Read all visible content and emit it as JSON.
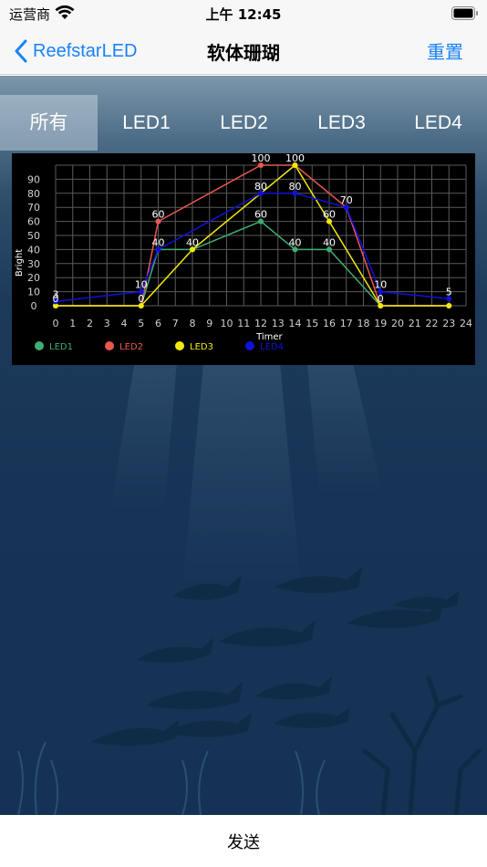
{
  "status_bar": {
    "carrier": "运营商",
    "time": "上午 12:45"
  },
  "nav": {
    "back_label": "ReefstarLED",
    "title": "软体珊瑚",
    "reset_label": "重置"
  },
  "tabs": [
    {
      "label": "所有",
      "active": true
    },
    {
      "label": "LED1",
      "active": false
    },
    {
      "label": "LED2",
      "active": false
    },
    {
      "label": "LED3",
      "active": false
    },
    {
      "label": "LED4",
      "active": false
    }
  ],
  "send_label": "发送",
  "colors": {
    "accent": "#1a82f7",
    "led1": "#3fae72",
    "led2": "#e8584f",
    "led3": "#f2ea0a",
    "led4": "#1010dd"
  },
  "chart_data": {
    "type": "line",
    "xlabel": "Timer",
    "ylabel": "Bright",
    "xlim": [
      0,
      24
    ],
    "ylim": [
      0,
      100
    ],
    "x_ticks": [
      0,
      1,
      2,
      3,
      4,
      5,
      6,
      7,
      8,
      9,
      10,
      11,
      12,
      13,
      14,
      15,
      16,
      17,
      18,
      19,
      20,
      21,
      22,
      23,
      24
    ],
    "y_ticks": [
      0,
      10,
      20,
      30,
      40,
      50,
      60,
      70,
      80,
      90
    ],
    "grid": true,
    "legend_position": "bottom-left",
    "series": [
      {
        "name": "LED1",
        "color": "#3fae72",
        "x": [
          0,
          5,
          6,
          8,
          12,
          14,
          16,
          19,
          23
        ],
        "y": [
          0,
          0,
          40,
          40,
          60,
          40,
          40,
          0,
          0
        ]
      },
      {
        "name": "LED2",
        "color": "#e8584f",
        "x": [
          0,
          5,
          6,
          12,
          14,
          17,
          19,
          23
        ],
        "y": [
          0,
          0,
          60,
          100,
          100,
          70,
          0,
          0
        ]
      },
      {
        "name": "LED3",
        "color": "#f2ea0a",
        "x": [
          0,
          5,
          8,
          14,
          16,
          19,
          23
        ],
        "y": [
          0,
          0,
          40,
          100,
          60,
          0,
          0
        ]
      },
      {
        "name": "LED4",
        "color": "#1010dd",
        "x": [
          0,
          5,
          6,
          12,
          14,
          17,
          19,
          23
        ],
        "y": [
          3,
          10,
          40,
          80,
          80,
          70,
          10,
          5
        ]
      }
    ],
    "point_labels": [
      {
        "x": 0,
        "y": 3,
        "text": "3"
      },
      {
        "x": 0,
        "y": 0,
        "text": "0"
      },
      {
        "x": 5,
        "y": 10,
        "text": "10"
      },
      {
        "x": 5,
        "y": 0,
        "text": "0"
      },
      {
        "x": 6,
        "y": 60,
        "text": "60"
      },
      {
        "x": 6,
        "y": 40,
        "text": "40"
      },
      {
        "x": 8,
        "y": 40,
        "text": "40"
      },
      {
        "x": 12,
        "y": 100,
        "text": "100"
      },
      {
        "x": 12,
        "y": 80,
        "text": "80"
      },
      {
        "x": 12,
        "y": 60,
        "text": "60"
      },
      {
        "x": 14,
        "y": 100,
        "text": "100"
      },
      {
        "x": 14,
        "y": 80,
        "text": "80"
      },
      {
        "x": 14,
        "y": 40,
        "text": "40"
      },
      {
        "x": 16,
        "y": 60,
        "text": "60"
      },
      {
        "x": 16,
        "y": 40,
        "text": "40"
      },
      {
        "x": 17,
        "y": 70,
        "text": "70"
      },
      {
        "x": 19,
        "y": 10,
        "text": "10"
      },
      {
        "x": 19,
        "y": 0,
        "text": "0"
      },
      {
        "x": 23,
        "y": 5,
        "text": "5"
      }
    ]
  }
}
